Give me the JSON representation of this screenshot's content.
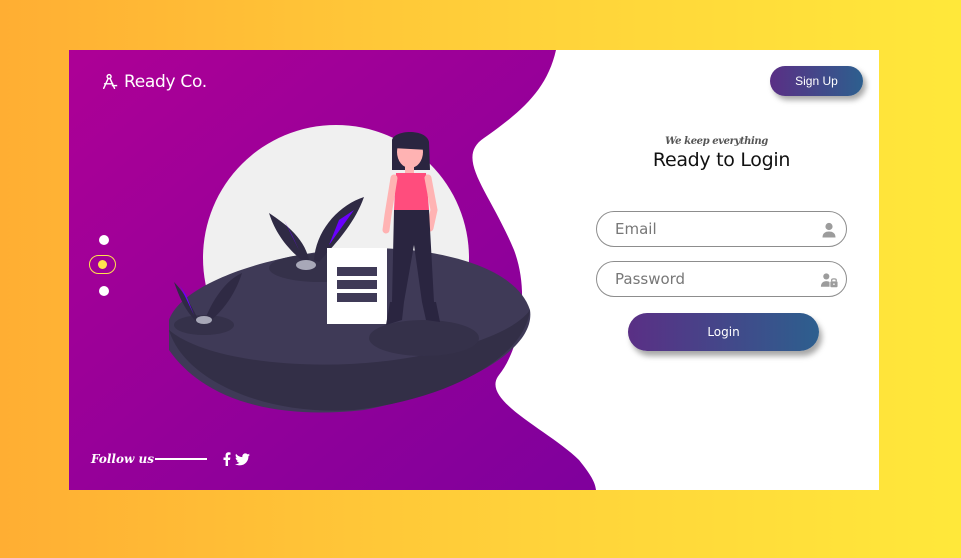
{
  "brand": {
    "name": "Ready Co.",
    "icon": "compass-logo-icon"
  },
  "header": {
    "signup_label": "Sign Up"
  },
  "form": {
    "tagline": "We keep everything",
    "title": "Ready to Login",
    "email_placeholder": "Email",
    "password_placeholder": "Password",
    "login_label": "Login",
    "email_icon": "user-icon",
    "password_icon": "user-lock-icon"
  },
  "carousel": {
    "dots": 3,
    "active_index": 1
  },
  "footer": {
    "follow_label": "Follow us",
    "social": [
      "facebook-icon",
      "twitter-icon"
    ]
  },
  "colors": {
    "background_left": "#ffae33",
    "background_right": "#ffe83a",
    "panel_purple_1": "#a0009c",
    "panel_purple_2": "#8c009c",
    "button_gradient_start": "#5a2f85",
    "button_gradient_end": "#2d5f8e",
    "active_dot": "#ffe34d"
  }
}
